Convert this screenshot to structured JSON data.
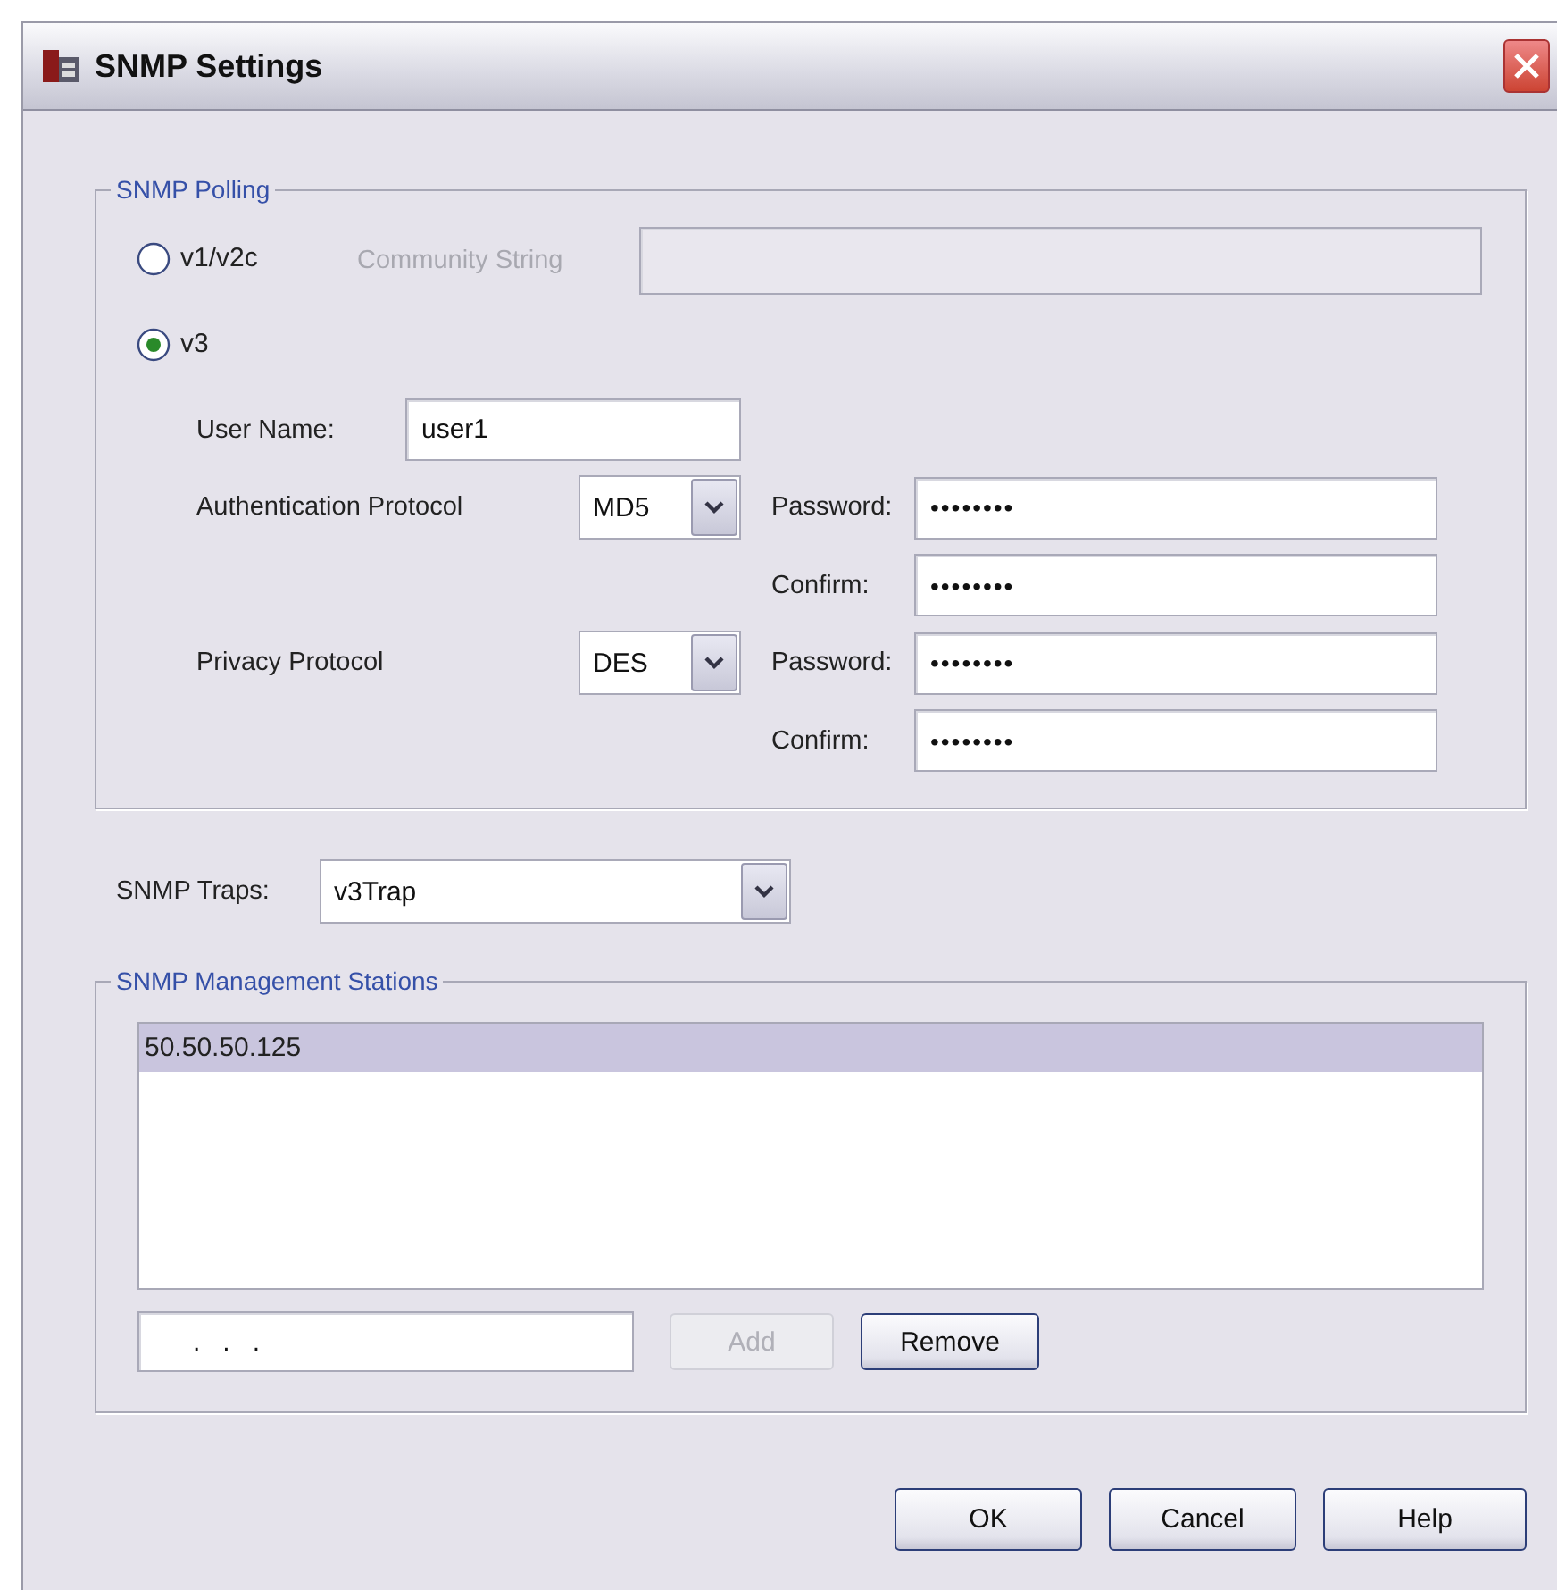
{
  "window": {
    "title": "SNMP Settings"
  },
  "polling": {
    "title": "SNMP Polling",
    "versions": [
      {
        "label": "v1/v2c",
        "selected": false
      },
      {
        "label": "v3",
        "selected": true
      }
    ],
    "community": {
      "label": "Community String",
      "disabled": true
    },
    "user_name": {
      "label": "User Name:",
      "value": "user1"
    },
    "protocols": [
      {
        "label": "Authentication Protocol",
        "value": "MD5",
        "password": {
          "label": "Password:",
          "value": "••••••••"
        },
        "confirm": {
          "label": "Confirm:",
          "value": "••••••••"
        }
      },
      {
        "label": "Privacy Protocol",
        "value": "DES",
        "password": {
          "label": "Password:",
          "value": "••••••••"
        },
        "confirm": {
          "label": "Confirm:",
          "value": "••••••••"
        }
      }
    ]
  },
  "traps": {
    "label": "SNMP Traps:",
    "value": "v3Trap"
  },
  "stations": {
    "title": "SNMP Management Stations",
    "items": [
      {
        "text": "50.50.50.125",
        "selected": true
      }
    ],
    "address": {
      "value": ".   .   ."
    },
    "buttons": [
      {
        "label": "Add",
        "disabled": true
      },
      {
        "label": "Remove",
        "disabled": false
      }
    ]
  },
  "buttons": [
    {
      "label": "OK"
    },
    {
      "label": "Cancel"
    },
    {
      "label": "Help"
    }
  ]
}
